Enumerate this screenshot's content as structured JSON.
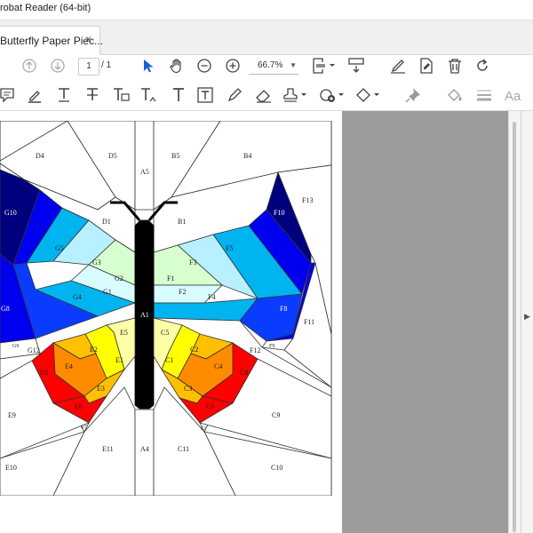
{
  "window": {
    "title": "robat Reader (64-bit)"
  },
  "tab": {
    "label": "Butterfly Paper Piec...",
    "close": "×"
  },
  "navigation": {
    "current_page": "1",
    "total_pages": "/ 1",
    "zoom": "66.7%"
  },
  "icons": {
    "toolbar1": [
      "arrow-up-circle-icon",
      "arrow-down-circle-icon",
      "select-arrow-icon",
      "hand-icon",
      "zoom-out-icon",
      "zoom-in-icon",
      "crop-fit-icon",
      "scroll-mode-icon",
      "sign-pen-icon",
      "form-fill-icon",
      "delete-icon",
      "rotate-icon"
    ],
    "toolbar2": [
      "comment-icon",
      "highlight-icon",
      "underline-text-icon",
      "strikethrough-text-icon",
      "replace-text-icon",
      "insert-text-icon",
      "add-text-icon",
      "text-box-icon",
      "pencil-icon",
      "eraser-icon",
      "stamp-icon",
      "attach-icon",
      "shapes-icon",
      "pin-icon",
      "fill-icon",
      "line-weight-icon",
      "font-size-icon"
    ]
  },
  "pattern": {
    "labels": {
      "D4": "D4",
      "D5": "D5",
      "A5": "A5",
      "B5": "B5",
      "B4": "B4",
      "F13": "F13",
      "G10": "G10",
      "F10": "F10",
      "D1": "D1",
      "B1": "B1",
      "G5": "G5",
      "F5": "F5",
      "G3": "G3",
      "F3": "F3",
      "G2": "G2",
      "F1": "F1",
      "G1": "G1",
      "F2": "F2",
      "G4": "G4",
      "F4": "F4",
      "G8": "G8",
      "F8": "F8",
      "A1": "A1",
      "F11": "F11",
      "E5": "E5",
      "C5": "C5",
      "G9": "G9",
      "F9": "F9",
      "G12": "G12",
      "F12": "F12",
      "E2": "E2",
      "C2": "C2",
      "E4": "E4",
      "C4": "C4",
      "E1": "E1",
      "C1": "C1",
      "E6": "E6",
      "C6": "C6",
      "E3": "E3",
      "C3": "C3",
      "E8": "E8",
      "C8": "C8",
      "E9": "E9",
      "C9": "C9",
      "E7": "E7",
      "C7": "C7",
      "E11": "E11",
      "A4": "A4",
      "C11": "C11",
      "E10": "E10",
      "C10": "C10"
    },
    "colors": {
      "dark_navy": "#00007f",
      "blue": "#0000ee",
      "royal": "#0a3cff",
      "sky": "#00b4f0",
      "light_cyan": "#b8f0ff",
      "pale_cyan": "#d8fcff",
      "pale_green": "#d8ffd0",
      "black": "#000000",
      "yellow": "#ffff00",
      "light_yellow": "#ffffa8",
      "amber": "#ffc000",
      "orange": "#ff8c00",
      "red": "#ff0000",
      "gray_panel": "#9c9c9c"
    }
  }
}
